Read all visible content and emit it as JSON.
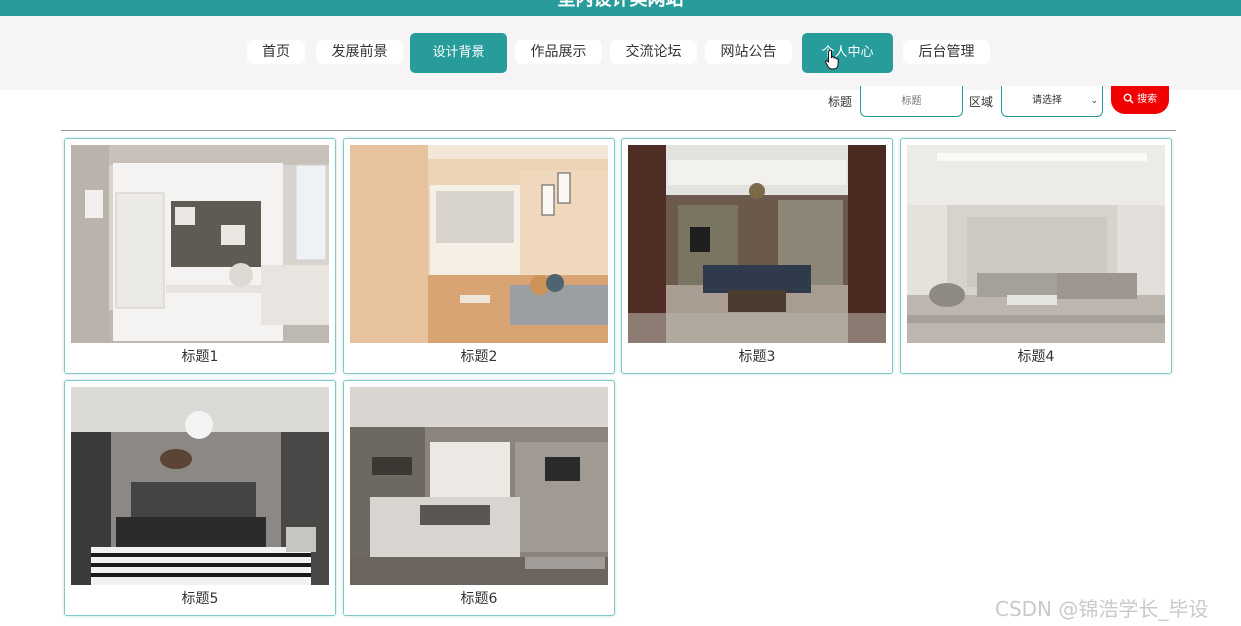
{
  "header": {
    "site_title": "室内设计美网站"
  },
  "nav": {
    "items": [
      {
        "label": "首页"
      },
      {
        "label": "发展前景"
      },
      {
        "label": "设计背景",
        "active": true
      },
      {
        "label": "作品展示"
      },
      {
        "label": "交流论坛"
      },
      {
        "label": "网站公告"
      },
      {
        "label": "个人中心",
        "active": true
      },
      {
        "label": "后台管理"
      }
    ]
  },
  "search": {
    "title_label": "标题",
    "title_placeholder": "标题",
    "region_label": "区域",
    "region_value": "请选择",
    "button_label": "搜索"
  },
  "gallery": {
    "items": [
      {
        "title": "标题1"
      },
      {
        "title": "标题2"
      },
      {
        "title": "标题3"
      },
      {
        "title": "标题4"
      },
      {
        "title": "标题5"
      },
      {
        "title": "标题6"
      }
    ]
  },
  "watermark": "CSDN @锦浩学长_毕设",
  "colors": {
    "accent": "#279c9b",
    "search_button": "#f00000",
    "nav_band": "#f6f4f4"
  }
}
